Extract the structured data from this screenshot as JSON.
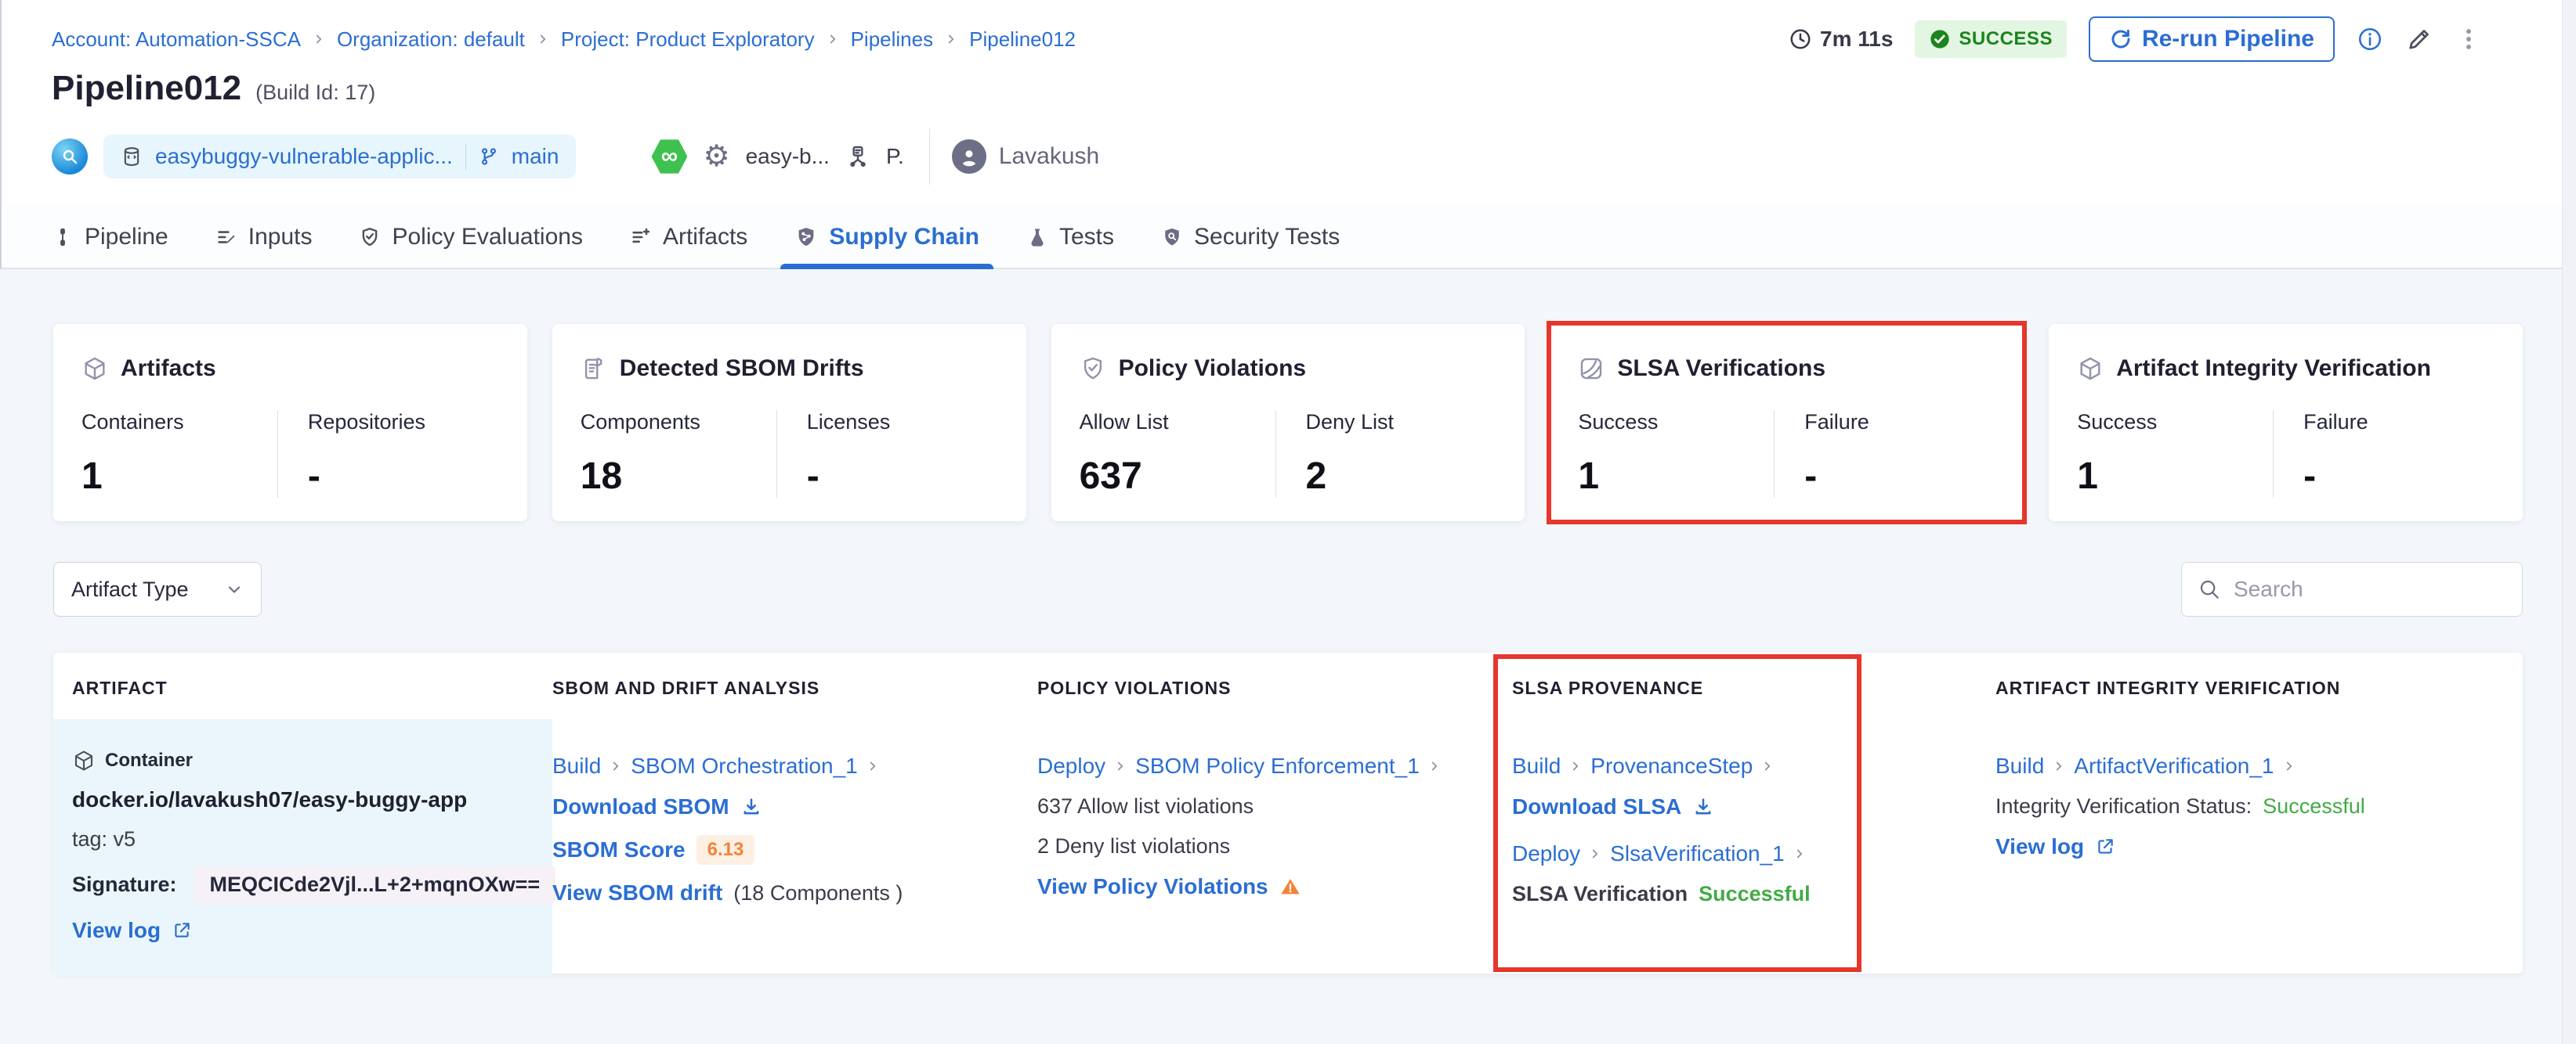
{
  "breadcrumb": {
    "items": [
      {
        "label": "Account: Automation-SSCA"
      },
      {
        "label": "Organization: default"
      },
      {
        "label": "Project: Product Exploratory"
      },
      {
        "label": "Pipelines"
      },
      {
        "label": "Pipeline012"
      }
    ]
  },
  "header": {
    "duration": "7m 11s",
    "status_badge": "SUCCESS",
    "rerun_button": "Re-run Pipeline",
    "title": "Pipeline012",
    "build_id": "(Build Id: 17)",
    "repo_name": "easybuggy-vulnerable-applic...",
    "branch_name": "main",
    "ci_symbol": "∞",
    "gear_symbol": "⚙",
    "service_name": "easy-b...",
    "env_abbrev": "P.",
    "user_name": "Lavakush"
  },
  "tabs": [
    {
      "label": "Pipeline"
    },
    {
      "label": "Inputs"
    },
    {
      "label": "Policy Evaluations"
    },
    {
      "label": "Artifacts"
    },
    {
      "label": "Supply Chain"
    },
    {
      "label": "Tests"
    },
    {
      "label": "Security Tests"
    }
  ],
  "summary_cards": [
    {
      "title": "Artifacts",
      "stats": [
        {
          "label": "Containers",
          "value": "1"
        },
        {
          "label": "Repositories",
          "value": "-"
        }
      ]
    },
    {
      "title": "Detected SBOM Drifts",
      "stats": [
        {
          "label": "Components",
          "value": "18"
        },
        {
          "label": "Licenses",
          "value": "-"
        }
      ]
    },
    {
      "title": "Policy Violations",
      "stats": [
        {
          "label": "Allow List",
          "value": "637"
        },
        {
          "label": "Deny List",
          "value": "2"
        }
      ]
    },
    {
      "title": "SLSA Verifications",
      "highlighted": true,
      "stats": [
        {
          "label": "Success",
          "value": "1"
        },
        {
          "label": "Failure",
          "value": "-"
        }
      ]
    },
    {
      "title": "Artifact Integrity Verification",
      "stats": [
        {
          "label": "Success",
          "value": "1"
        },
        {
          "label": "Failure",
          "value": "-"
        }
      ]
    }
  ],
  "filter_bar": {
    "artifact_type_label": "Artifact Type",
    "search_placeholder": "Search"
  },
  "table": {
    "columns": [
      "ARTIFACT",
      "SBOM AND DRIFT ANALYSIS",
      "POLICY VIOLATIONS",
      "SLSA PROVENANCE",
      "ARTIFACT INTEGRITY VERIFICATION"
    ],
    "row": {
      "artifact": {
        "type": "Container",
        "image": "docker.io/lavakush07/easy-buggy-app",
        "tag": "tag: v5",
        "signature_label": "Signature:",
        "signature_value": "MEQCICde2Vjl...L+2+mqnOXw==",
        "view_log_label": "View log"
      },
      "sbom": {
        "stage": "Build",
        "step": "SBOM Orchestration_1",
        "download_label": "Download SBOM",
        "score_label": "SBOM Score",
        "score_value": "6.13",
        "drift_link": "View SBOM drift",
        "drift_count": "(18 Components )"
      },
      "policy": {
        "stage": "Deploy",
        "step": "SBOM Policy Enforcement_1",
        "allow_text": "637 Allow list violations",
        "deny_text": "2 Deny list violations",
        "link": "View Policy Violations"
      },
      "slsa": {
        "stage1": "Build",
        "step1": "ProvenanceStep",
        "download_label": "Download SLSA",
        "stage2": "Deploy",
        "step2": "SlsaVerification_1",
        "status_label": "SLSA Verification",
        "status_value": "Successful"
      },
      "integrity": {
        "stage": "Build",
        "step": "ArtifactVerification_1",
        "status_label": "Integrity Verification Status:",
        "status_value": "Successful",
        "view_log_label": "View log"
      }
    }
  },
  "colors": {
    "accent_blue": "#2b6ed3",
    "success_green": "#42ab45",
    "badge_green": "#1b841d",
    "highlight_red": "#e5372b",
    "warning_orange": "#f4823b"
  }
}
